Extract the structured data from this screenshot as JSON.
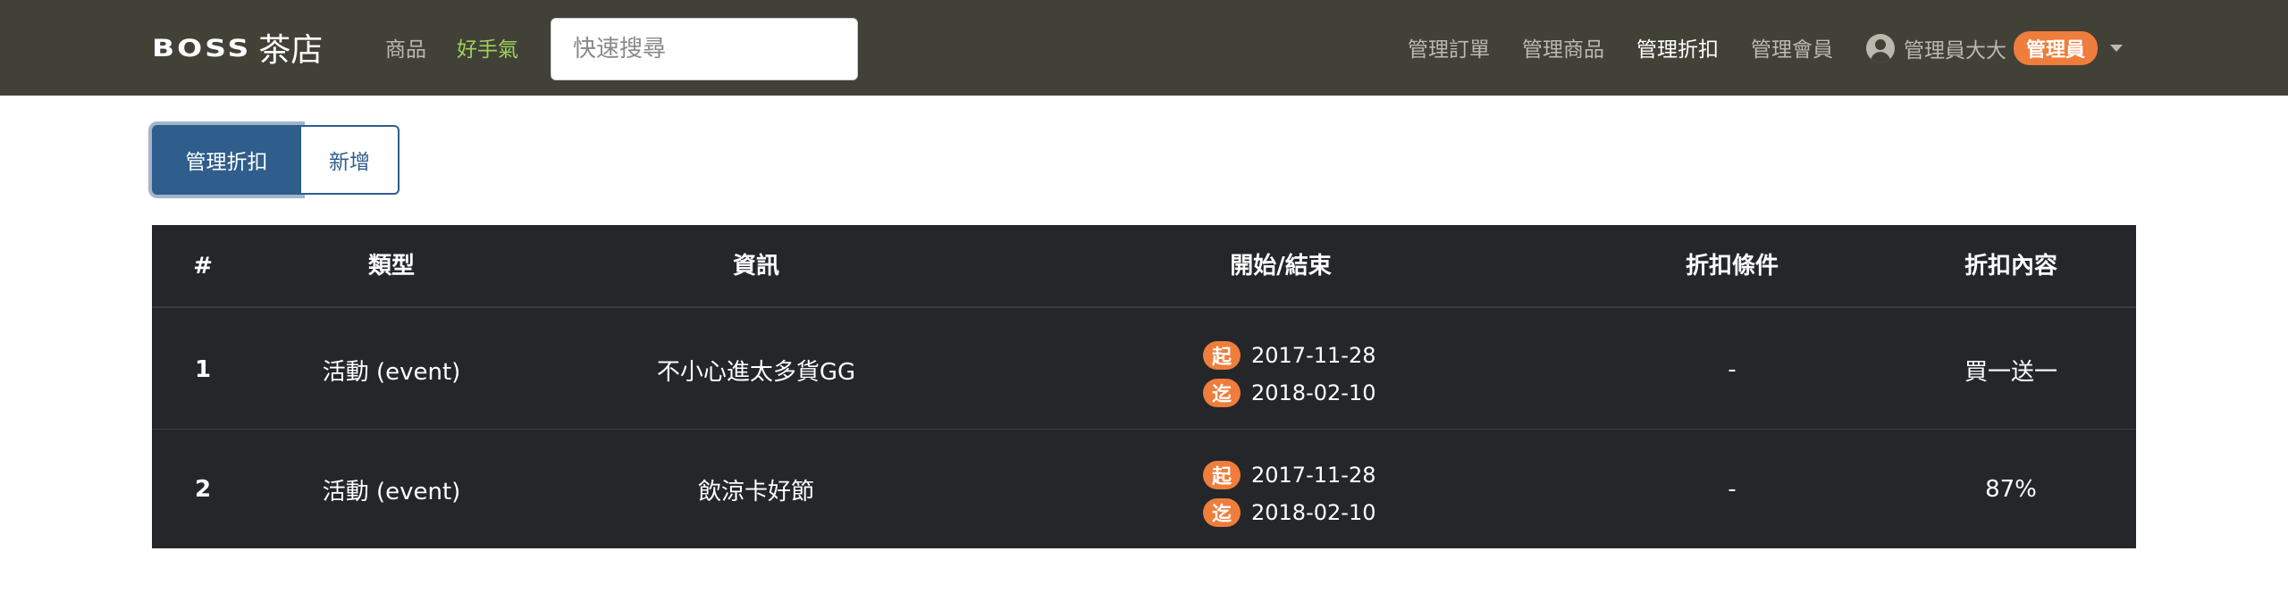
{
  "navbar": {
    "brand_en": "BOSS",
    "brand_zh": "茶店",
    "links_left": [
      "商品",
      "好手氣"
    ],
    "search_placeholder": "快速搜尋",
    "links_right": [
      "管理訂單",
      "管理商品",
      "管理折扣",
      "管理會員"
    ],
    "active_right": "管理折扣",
    "user_name": "管理員大大",
    "user_role": "管理員",
    "colors": {
      "bg": "#414138",
      "accent_green": "#9fd05a",
      "badge_orange": "#ef7d3c"
    }
  },
  "tabs": {
    "manage_label": "管理折扣",
    "add_label": "新增"
  },
  "table": {
    "headers": [
      "#",
      "類型",
      "資訊",
      "開始/結束",
      "折扣條件",
      "折扣內容"
    ],
    "start_badge": "起",
    "end_badge": "迄",
    "rows": [
      {
        "num": "1",
        "type": "活動 (event)",
        "info": "不小心進太多貨GG",
        "start": "2017-11-28",
        "end": "2018-02-10",
        "condition": "-",
        "content": "買一送一"
      },
      {
        "num": "2",
        "type": "活動 (event)",
        "info": "飲涼卡好節",
        "start": "2017-11-28",
        "end": "2018-02-10",
        "condition": "-",
        "content": "87%"
      }
    ]
  }
}
